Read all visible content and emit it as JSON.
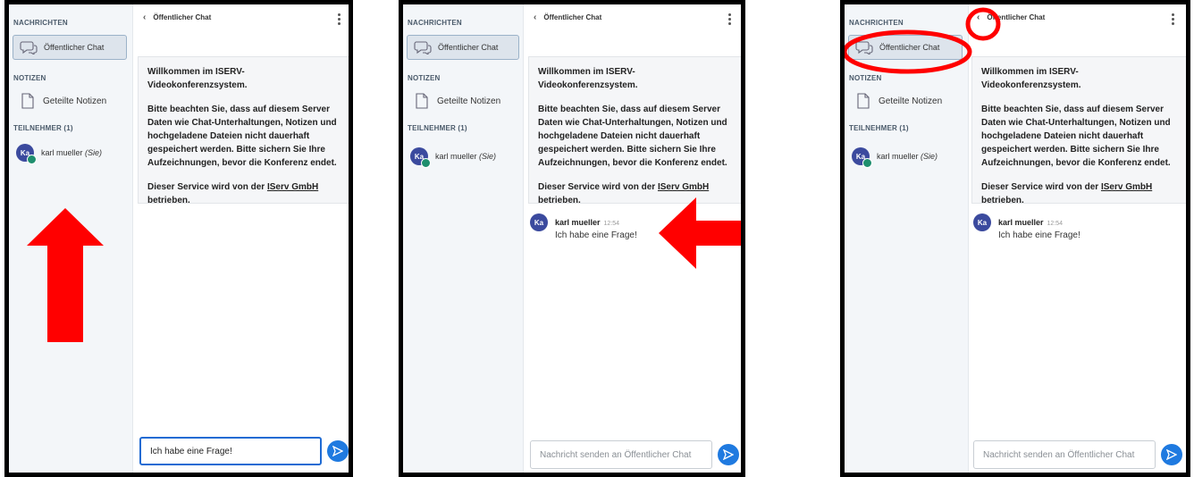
{
  "labels": {
    "nachrichten": "NACHRICHTEN",
    "oeffentlicher_chat": "Öffentlicher Chat",
    "notizen": "NOTIZEN",
    "geteilte_notizen": "Geteilte Notizen",
    "teilnehmer": "TEILNEHMER (1)",
    "user_name": "karl mueller",
    "user_you": "(Sie)",
    "avatar_initials": "Ka",
    "header_title": "Öffentlicher Chat",
    "welcome_1": "Willkommen im ISERV-Videokonferenzsystem.",
    "welcome_2": "Bitte beachten Sie, dass auf diesem Server Daten wie Chat-Unterhaltungen, Notizen und hochgeladene Dateien nicht dauerhaft gespeichert werden. Bitte sichern Sie Ihre Aufzeichnungen, bevor die Konferenz endet.",
    "welcome_3_pre": "Dieser Service wird von der ",
    "welcome_3_link": "IServ GmbH",
    "welcome_3_post": "betrieben.",
    "msg_time": "12:54",
    "msg_text": "Ich habe eine Frage!",
    "composer_typed": "Ich habe eine Frage!",
    "composer_placeholder": "Nachricht senden an Öffentlicher Chat"
  },
  "colors": {
    "annotation_red": "#ff0000",
    "send_button": "#1f7ae0",
    "avatar": "#3b4a9e"
  }
}
